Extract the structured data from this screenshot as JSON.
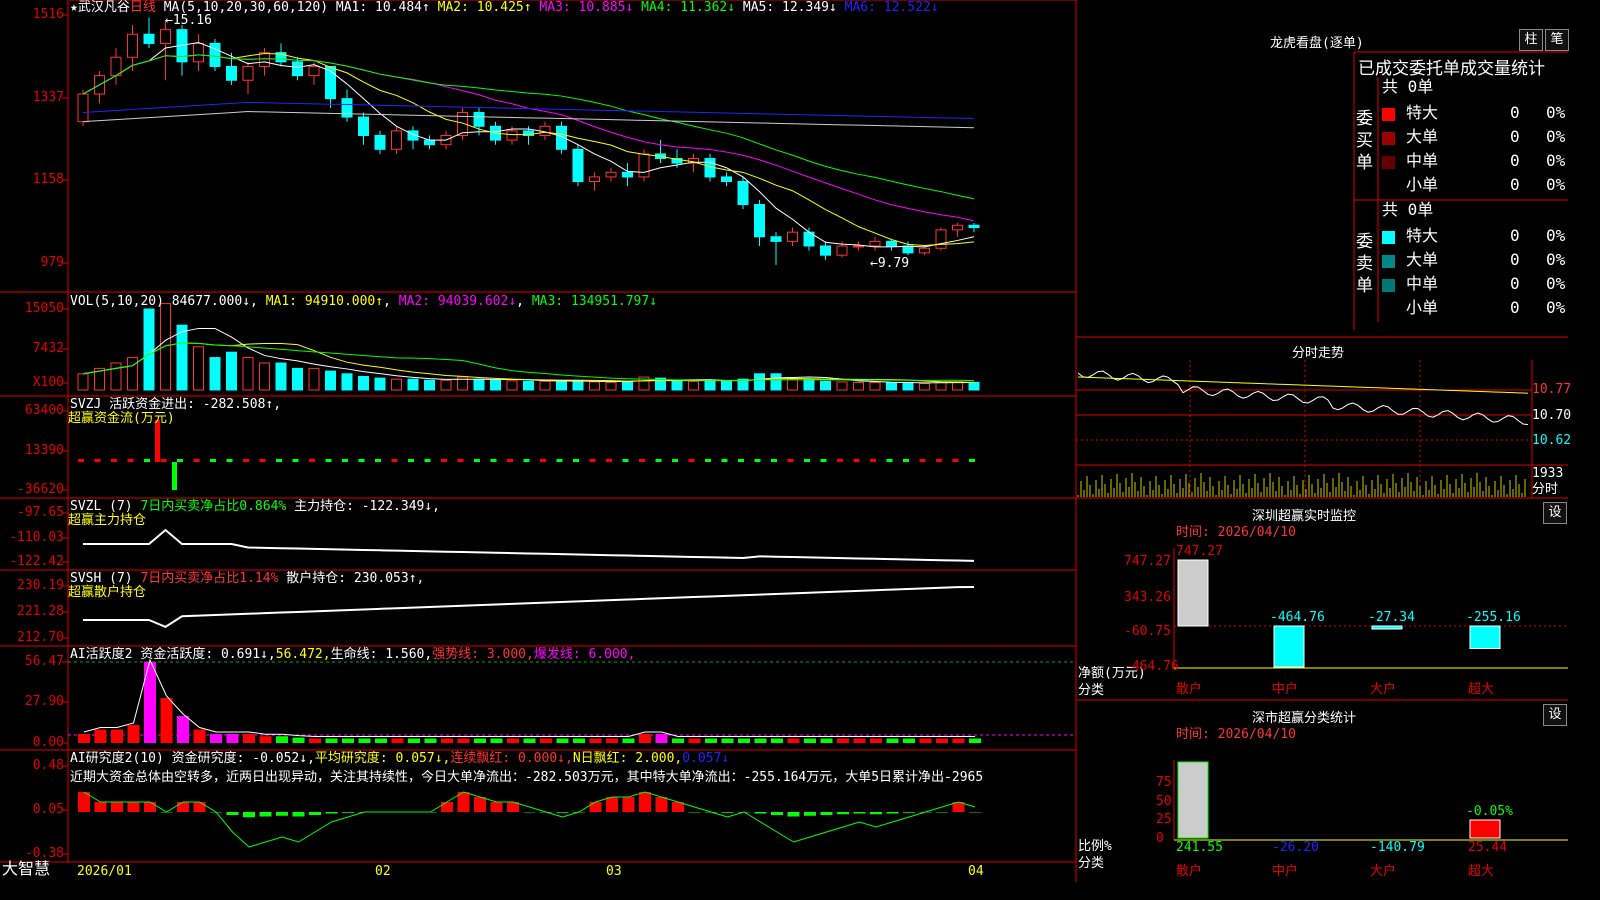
{
  "stock": {
    "name": "武汉凡谷",
    "period": "日线"
  },
  "main_header": {
    "ma": "MA(5,10,20,30,60,120)",
    "ma1": "MA1: 10.484↑",
    "ma2": "MA2: 10.425↑",
    "ma3": "MA3: 10.885↓",
    "ma4": "MA4: 11.362↓",
    "ma5": "MA5: 12.349↓",
    "ma6": "MA6: 12.522↓"
  },
  "annotations": {
    "high": "15.16",
    "low": "9.79"
  },
  "vol_header": {
    "label": "VOL(5,10,20)",
    "vol": "84677.000↓",
    "ma1": "MA1: 94910.000↑",
    "ma2": "MA2: 94039.602↓",
    "ma3": "MA3: 134951.797↓"
  },
  "svzj_header": {
    "label": "SVZJ",
    "text": "活跃资金进出: -282.508↑,",
    "sub": "超赢资金流(万元)"
  },
  "svzl_header": {
    "label": "SVZL (7)",
    "pct": "7日内买卖净占比0.864%",
    "text": "主力持仓: -122.349↓,",
    "sub": "超赢主力持仓"
  },
  "svsh_header": {
    "label": "SVSH (7)",
    "pct": "7日内买卖净占比1.14%",
    "text": "散户持仓: 230.053↑,",
    "sub": "超赢散户持仓"
  },
  "ai1_header": {
    "label": "AI活跃度2",
    "t1": "资金活跃度: 0.691↓,",
    "t2": "56.472,",
    "t3": "生命线: 1.560,",
    "t4": "强势线: 3.000,",
    "t5": "爆发线: 6.000,"
  },
  "ai2_header": {
    "label": "AI研究度2(10)",
    "t1": "资金研究度: -0.052↓,",
    "t2": "平均研究度: 0.057↓,",
    "t3": "连续飘红: 0.000↓,",
    "t4": "N日飘红: 2.000,",
    "t5": "0.057↓",
    "comment": "近期大资金总体由空转多，近两日出现异动，关注其持续性，今日大单净流出：-282.503万元，其中特大单净流出：-255.164万元，大单5日累计净出-2965"
  },
  "y_axes": {
    "main": [
      "1516",
      "1337",
      "1158",
      "979"
    ],
    "vol": [
      "15050",
      "7432",
      "X100"
    ],
    "svzj": [
      "63400",
      "13390",
      "-36620"
    ],
    "svzl": [
      "-97.65",
      "-110.03",
      "-122.42"
    ],
    "svsh": [
      "230.19",
      "221.28",
      "212.70"
    ],
    "ai1": [
      "56.47",
      "27.90",
      "0.00"
    ],
    "ai2": [
      "0.48",
      "0.05",
      "-0.38"
    ]
  },
  "x_axis": {
    "labels": [
      "2026/01",
      "02",
      "03",
      "04"
    ],
    "brand": "大智慧"
  },
  "longhu": {
    "title": "龙虎看盘(逐单)",
    "btn1": "柱",
    "btn2": "笔",
    "subtitle": "已成交委托单成交量统计",
    "buy": {
      "side": "委买单",
      "total": "共 0单",
      "rows": [
        {
          "name": "特大",
          "v": "0",
          "p": "0%",
          "color": "#f00"
        },
        {
          "name": "大单",
          "v": "0",
          "p": "0%",
          "color": "#900"
        },
        {
          "name": "中单",
          "v": "0",
          "p": "0%",
          "color": "#600"
        },
        {
          "name": "小单",
          "v": "0",
          "p": "0%",
          "color": "#000"
        }
      ]
    },
    "sell": {
      "side": "委卖单",
      "total": "共 0单",
      "rows": [
        {
          "name": "特大",
          "v": "0",
          "p": "0%",
          "color": "#0ff"
        },
        {
          "name": "大单",
          "v": "0",
          "p": "0%",
          "color": "#088"
        },
        {
          "name": "中单",
          "v": "0",
          "p": "0%",
          "color": "#077"
        },
        {
          "name": "小单",
          "v": "0",
          "p": "0%",
          "color": "#000"
        }
      ]
    }
  },
  "intraday": {
    "title": "分时走势",
    "prices": [
      "10.77",
      "10.70",
      "10.62"
    ],
    "vol_label": "1933",
    "unit": "分时"
  },
  "monitor": {
    "title": "深圳超赢实时监控",
    "btn": "设",
    "time": "时间: 2026/04/10",
    "yaxis": [
      "747.27",
      "343.26",
      "-60.75",
      "-464.76"
    ],
    "ylabel": "净额(万元)",
    "xlabel": "分类",
    "bars": [
      {
        "cat": "散户",
        "v": "747.27"
      },
      {
        "cat": "中户",
        "v": "-464.76"
      },
      {
        "cat": "大户",
        "v": "-27.34"
      },
      {
        "cat": "超大",
        "v": "-255.16"
      }
    ]
  },
  "classify": {
    "title": "深市超赢分类统计",
    "btn": "设",
    "time": "时间: 2026/04/10",
    "yaxis": [
      "75",
      "50",
      "25",
      "0"
    ],
    "ylabel": "比例%",
    "xlabel": "分类",
    "top_pct": "-0.05%",
    "bars": [
      {
        "cat": "散户",
        "v": "241.55"
      },
      {
        "cat": "中户",
        "v": "-26.20"
      },
      {
        "cat": "大户",
        "v": "-140.79"
      },
      {
        "cat": "超大",
        "v": "25.44"
      }
    ]
  },
  "chart_data": {
    "type": "candlestick",
    "title": "武汉凡谷 日线",
    "ohlc": [
      [
        12.9,
        13.6,
        12.8,
        13.5
      ],
      [
        13.5,
        14.0,
        13.3,
        13.9
      ],
      [
        13.9,
        14.5,
        13.7,
        14.3
      ],
      [
        14.3,
        15.0,
        14.0,
        14.8
      ],
      [
        14.8,
        15.16,
        14.5,
        14.6
      ],
      [
        14.6,
        15.1,
        13.8,
        14.9
      ],
      [
        14.9,
        15.0,
        13.9,
        14.2
      ],
      [
        14.2,
        14.8,
        14.0,
        14.6
      ],
      [
        14.6,
        14.7,
        14.0,
        14.1
      ],
      [
        14.1,
        14.4,
        13.7,
        13.8
      ],
      [
        13.8,
        14.2,
        13.5,
        14.1
      ],
      [
        14.1,
        14.5,
        13.9,
        14.4
      ],
      [
        14.4,
        14.6,
        14.1,
        14.2
      ],
      [
        14.2,
        14.3,
        13.8,
        13.9
      ],
      [
        13.9,
        14.2,
        13.7,
        14.1
      ],
      [
        14.1,
        14.1,
        13.2,
        13.4
      ],
      [
        13.4,
        13.6,
        12.9,
        13.0
      ],
      [
        13.0,
        13.1,
        12.4,
        12.6
      ],
      [
        12.6,
        12.7,
        12.2,
        12.3
      ],
      [
        12.3,
        12.8,
        12.2,
        12.7
      ],
      [
        12.7,
        12.8,
        12.3,
        12.5
      ],
      [
        12.5,
        12.6,
        12.3,
        12.4
      ],
      [
        12.4,
        12.7,
        12.3,
        12.6
      ],
      [
        12.6,
        13.2,
        12.5,
        13.1
      ],
      [
        13.1,
        13.2,
        12.6,
        12.8
      ],
      [
        12.8,
        12.9,
        12.4,
        12.5
      ],
      [
        12.5,
        12.8,
        12.4,
        12.7
      ],
      [
        12.7,
        12.8,
        12.4,
        12.6
      ],
      [
        12.6,
        12.9,
        12.5,
        12.8
      ],
      [
        12.8,
        12.9,
        12.2,
        12.3
      ],
      [
        12.3,
        12.4,
        11.5,
        11.6
      ],
      [
        11.6,
        11.8,
        11.4,
        11.7
      ],
      [
        11.7,
        11.9,
        11.6,
        11.8
      ],
      [
        11.8,
        12.0,
        11.5,
        11.7
      ],
      [
        11.7,
        12.3,
        11.6,
        12.2
      ],
      [
        12.2,
        12.5,
        12.0,
        12.1
      ],
      [
        12.1,
        12.3,
        11.9,
        12.0
      ],
      [
        12.0,
        12.2,
        11.8,
        12.1
      ],
      [
        12.1,
        12.2,
        11.6,
        11.7
      ],
      [
        11.7,
        11.8,
        11.5,
        11.6
      ],
      [
        11.6,
        11.7,
        11.0,
        11.1
      ],
      [
        11.1,
        11.2,
        10.2,
        10.4
      ],
      [
        10.4,
        10.5,
        9.79,
        10.3
      ],
      [
        10.3,
        10.6,
        10.2,
        10.5
      ],
      [
        10.5,
        10.6,
        10.1,
        10.2
      ],
      [
        10.2,
        10.3,
        9.9,
        10.0
      ],
      [
        10.0,
        10.3,
        9.95,
        10.2
      ],
      [
        10.2,
        10.3,
        10.1,
        10.2
      ],
      [
        10.2,
        10.4,
        10.1,
        10.3
      ],
      [
        10.3,
        10.35,
        10.1,
        10.2
      ],
      [
        10.2,
        10.3,
        10.0,
        10.05
      ],
      [
        10.05,
        10.2,
        10.0,
        10.15
      ],
      [
        10.15,
        10.6,
        10.1,
        10.55
      ],
      [
        10.55,
        10.7,
        10.4,
        10.65
      ],
      [
        10.65,
        10.7,
        10.5,
        10.6
      ]
    ],
    "ylim": [
      9.2,
      15.5
    ]
  }
}
